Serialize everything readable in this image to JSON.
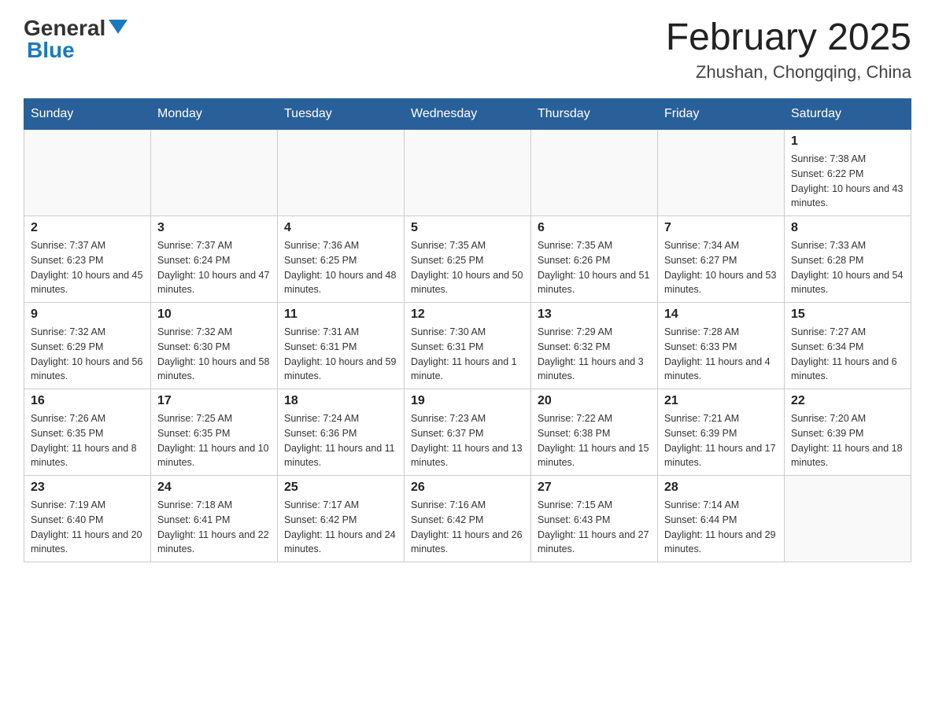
{
  "header": {
    "logo": {
      "general": "General",
      "blue": "Blue"
    },
    "title": "February 2025",
    "location": "Zhushan, Chongqing, China"
  },
  "days_of_week": [
    "Sunday",
    "Monday",
    "Tuesday",
    "Wednesday",
    "Thursday",
    "Friday",
    "Saturday"
  ],
  "weeks": [
    [
      {
        "day": "",
        "info": ""
      },
      {
        "day": "",
        "info": ""
      },
      {
        "day": "",
        "info": ""
      },
      {
        "day": "",
        "info": ""
      },
      {
        "day": "",
        "info": ""
      },
      {
        "day": "",
        "info": ""
      },
      {
        "day": "1",
        "info": "Sunrise: 7:38 AM\nSunset: 6:22 PM\nDaylight: 10 hours and 43 minutes."
      }
    ],
    [
      {
        "day": "2",
        "info": "Sunrise: 7:37 AM\nSunset: 6:23 PM\nDaylight: 10 hours and 45 minutes."
      },
      {
        "day": "3",
        "info": "Sunrise: 7:37 AM\nSunset: 6:24 PM\nDaylight: 10 hours and 47 minutes."
      },
      {
        "day": "4",
        "info": "Sunrise: 7:36 AM\nSunset: 6:25 PM\nDaylight: 10 hours and 48 minutes."
      },
      {
        "day": "5",
        "info": "Sunrise: 7:35 AM\nSunset: 6:25 PM\nDaylight: 10 hours and 50 minutes."
      },
      {
        "day": "6",
        "info": "Sunrise: 7:35 AM\nSunset: 6:26 PM\nDaylight: 10 hours and 51 minutes."
      },
      {
        "day": "7",
        "info": "Sunrise: 7:34 AM\nSunset: 6:27 PM\nDaylight: 10 hours and 53 minutes."
      },
      {
        "day": "8",
        "info": "Sunrise: 7:33 AM\nSunset: 6:28 PM\nDaylight: 10 hours and 54 minutes."
      }
    ],
    [
      {
        "day": "9",
        "info": "Sunrise: 7:32 AM\nSunset: 6:29 PM\nDaylight: 10 hours and 56 minutes."
      },
      {
        "day": "10",
        "info": "Sunrise: 7:32 AM\nSunset: 6:30 PM\nDaylight: 10 hours and 58 minutes."
      },
      {
        "day": "11",
        "info": "Sunrise: 7:31 AM\nSunset: 6:31 PM\nDaylight: 10 hours and 59 minutes."
      },
      {
        "day": "12",
        "info": "Sunrise: 7:30 AM\nSunset: 6:31 PM\nDaylight: 11 hours and 1 minute."
      },
      {
        "day": "13",
        "info": "Sunrise: 7:29 AM\nSunset: 6:32 PM\nDaylight: 11 hours and 3 minutes."
      },
      {
        "day": "14",
        "info": "Sunrise: 7:28 AM\nSunset: 6:33 PM\nDaylight: 11 hours and 4 minutes."
      },
      {
        "day": "15",
        "info": "Sunrise: 7:27 AM\nSunset: 6:34 PM\nDaylight: 11 hours and 6 minutes."
      }
    ],
    [
      {
        "day": "16",
        "info": "Sunrise: 7:26 AM\nSunset: 6:35 PM\nDaylight: 11 hours and 8 minutes."
      },
      {
        "day": "17",
        "info": "Sunrise: 7:25 AM\nSunset: 6:35 PM\nDaylight: 11 hours and 10 minutes."
      },
      {
        "day": "18",
        "info": "Sunrise: 7:24 AM\nSunset: 6:36 PM\nDaylight: 11 hours and 11 minutes."
      },
      {
        "day": "19",
        "info": "Sunrise: 7:23 AM\nSunset: 6:37 PM\nDaylight: 11 hours and 13 minutes."
      },
      {
        "day": "20",
        "info": "Sunrise: 7:22 AM\nSunset: 6:38 PM\nDaylight: 11 hours and 15 minutes."
      },
      {
        "day": "21",
        "info": "Sunrise: 7:21 AM\nSunset: 6:39 PM\nDaylight: 11 hours and 17 minutes."
      },
      {
        "day": "22",
        "info": "Sunrise: 7:20 AM\nSunset: 6:39 PM\nDaylight: 11 hours and 18 minutes."
      }
    ],
    [
      {
        "day": "23",
        "info": "Sunrise: 7:19 AM\nSunset: 6:40 PM\nDaylight: 11 hours and 20 minutes."
      },
      {
        "day": "24",
        "info": "Sunrise: 7:18 AM\nSunset: 6:41 PM\nDaylight: 11 hours and 22 minutes."
      },
      {
        "day": "25",
        "info": "Sunrise: 7:17 AM\nSunset: 6:42 PM\nDaylight: 11 hours and 24 minutes."
      },
      {
        "day": "26",
        "info": "Sunrise: 7:16 AM\nSunset: 6:42 PM\nDaylight: 11 hours and 26 minutes."
      },
      {
        "day": "27",
        "info": "Sunrise: 7:15 AM\nSunset: 6:43 PM\nDaylight: 11 hours and 27 minutes."
      },
      {
        "day": "28",
        "info": "Sunrise: 7:14 AM\nSunset: 6:44 PM\nDaylight: 11 hours and 29 minutes."
      },
      {
        "day": "",
        "info": ""
      }
    ]
  ]
}
